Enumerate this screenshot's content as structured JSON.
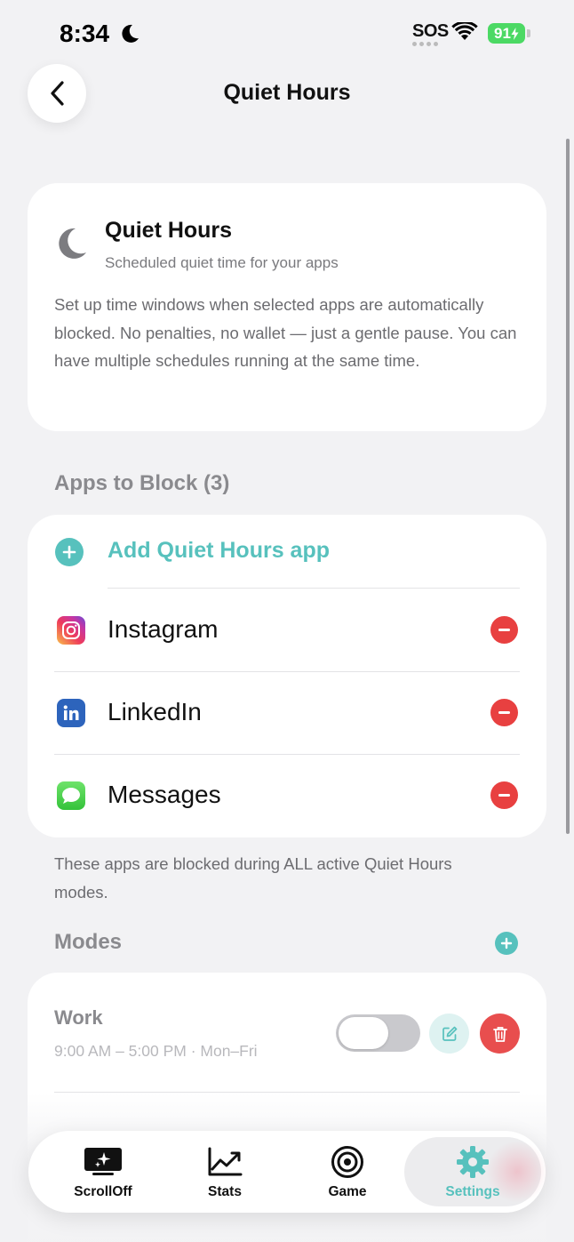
{
  "status_bar": {
    "time": "8:34",
    "carrier": "SOS",
    "battery": "91"
  },
  "header": {
    "title": "Quiet Hours"
  },
  "intro": {
    "title": "Quiet Hours",
    "subtitle": "Scheduled quiet time for your apps",
    "description": "Set up time windows when selected apps are automatically blocked. No penalties, no wallet — just a gentle pause. You can have multiple schedules running at the same time."
  },
  "apps_section": {
    "title": "Apps to Block (3)",
    "add_label": "Add Quiet Hours app",
    "apps": [
      {
        "name": "Instagram",
        "icon": "instagram-icon"
      },
      {
        "name": "LinkedIn",
        "icon": "linkedin-icon"
      },
      {
        "name": "Messages",
        "icon": "messages-icon"
      }
    ],
    "note": "These apps are blocked during ALL active Quiet Hours modes."
  },
  "modes_section": {
    "title": "Modes",
    "modes": [
      {
        "name": "Work",
        "schedule": "9:00 AM – 5:00 PM · Mon–Fri",
        "enabled": false
      }
    ]
  },
  "tab_bar": {
    "tabs": [
      {
        "label": "ScrollOff",
        "icon": "scrolloff-icon"
      },
      {
        "label": "Stats",
        "icon": "stats-icon"
      },
      {
        "label": "Game",
        "icon": "target-icon"
      },
      {
        "label": "Settings",
        "icon": "gear-icon",
        "active": true
      }
    ]
  },
  "colors": {
    "accent": "#57c1bd",
    "danger": "#e84040",
    "background": "#f2f2f4"
  }
}
